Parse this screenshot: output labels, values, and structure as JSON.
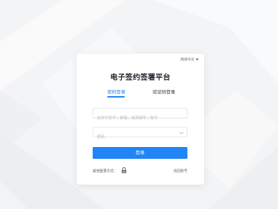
{
  "language_switch": {
    "label": "简体中文",
    "icon": "caret-down-icon"
  },
  "title": "电子签约签署平台",
  "tabs": [
    {
      "label": "密码登录",
      "active": true
    },
    {
      "label": "验证码登录",
      "active": false
    }
  ],
  "account": {
    "value": "",
    "placeholder": "支持手机号 / 邮箱 / 成员编号 / 账号"
  },
  "password": {
    "value": "",
    "placeholder": "密码",
    "toggle_icon": "eye-closed-icon"
  },
  "login_button": {
    "label": "登录"
  },
  "other_login": {
    "label": "其他登录方式：",
    "icon": "lock-icon"
  },
  "forgot": {
    "label": "找回账号"
  },
  "colors": {
    "accent": "#2185f5",
    "background": "#f4f5f7",
    "card": "#ffffff"
  }
}
